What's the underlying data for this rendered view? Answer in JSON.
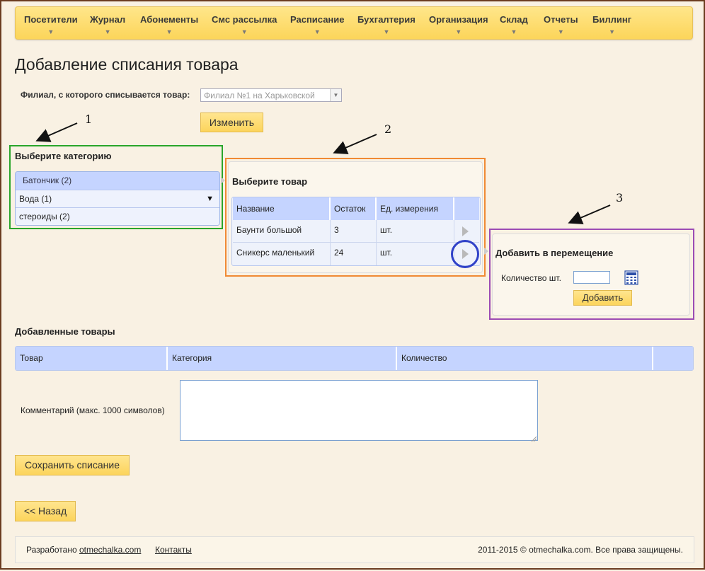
{
  "nav": [
    {
      "label": "Посетители",
      "arrow": "▼"
    },
    {
      "label": "Журнал",
      "arrow": "▼"
    },
    {
      "label": "Абонементы",
      "arrow": "▼"
    },
    {
      "label": "Смс рассылка",
      "arrow": "▼"
    },
    {
      "label": "Расписание",
      "arrow": "▼"
    },
    {
      "label": "Бухгалтерия",
      "arrow": "▼"
    },
    {
      "label": "Организация",
      "arrow": "▼"
    },
    {
      "label": "Склад",
      "arrow": "▼"
    },
    {
      "label": "Отчеты",
      "arrow": "▼"
    },
    {
      "label": "Биллинг",
      "arrow": "▼"
    }
  ],
  "page_title": "Добавление списания товара",
  "branch": {
    "label": "Филиал, с которого списывается товар:",
    "selected": "Филиал №1 на Харьковской",
    "change_button": "Изменить"
  },
  "annotations": {
    "one": "1",
    "two": "2",
    "three": "3"
  },
  "categories": {
    "title": "Выберите категорию",
    "items": [
      "Батончик (2)",
      "Вода (1)",
      "стероиды (2)"
    ],
    "expand_marker": "▼"
  },
  "products": {
    "title": "Выберите товар",
    "columns": [
      "Название",
      "Остаток",
      "Ед. измерения"
    ],
    "rows": [
      {
        "name": "Баунти большой",
        "stock": "3",
        "unit": "шт."
      },
      {
        "name": "Сникерс маленький",
        "stock": "24",
        "unit": "шт."
      }
    ]
  },
  "add_panel": {
    "title": "Добавить в перемещение",
    "qty_label": "Количество шт.",
    "qty_value": "",
    "add_button": "Добавить"
  },
  "added": {
    "title": "Добавленные товары",
    "columns": [
      "Товар",
      "Категория",
      "Количество"
    ]
  },
  "comment": {
    "label": "Комментарий (макс. 1000 символов)",
    "value": ""
  },
  "save_button": "Сохранить списание",
  "back_button": "<< Назад",
  "footer": {
    "developed_by": "Разработано",
    "dev_link": "otmechalka.com",
    "contacts": "Контакты",
    "copyright": "2011-2015 © otmechalka.com. Все права защищены."
  },
  "colors": {
    "nav_bg": "#fcd55a",
    "table_header": "#c5d4ff",
    "highlight_green": "#2aa52a",
    "highlight_orange": "#f08a34",
    "highlight_purple": "#9c4bb4",
    "circle_blue": "#3042c8"
  }
}
